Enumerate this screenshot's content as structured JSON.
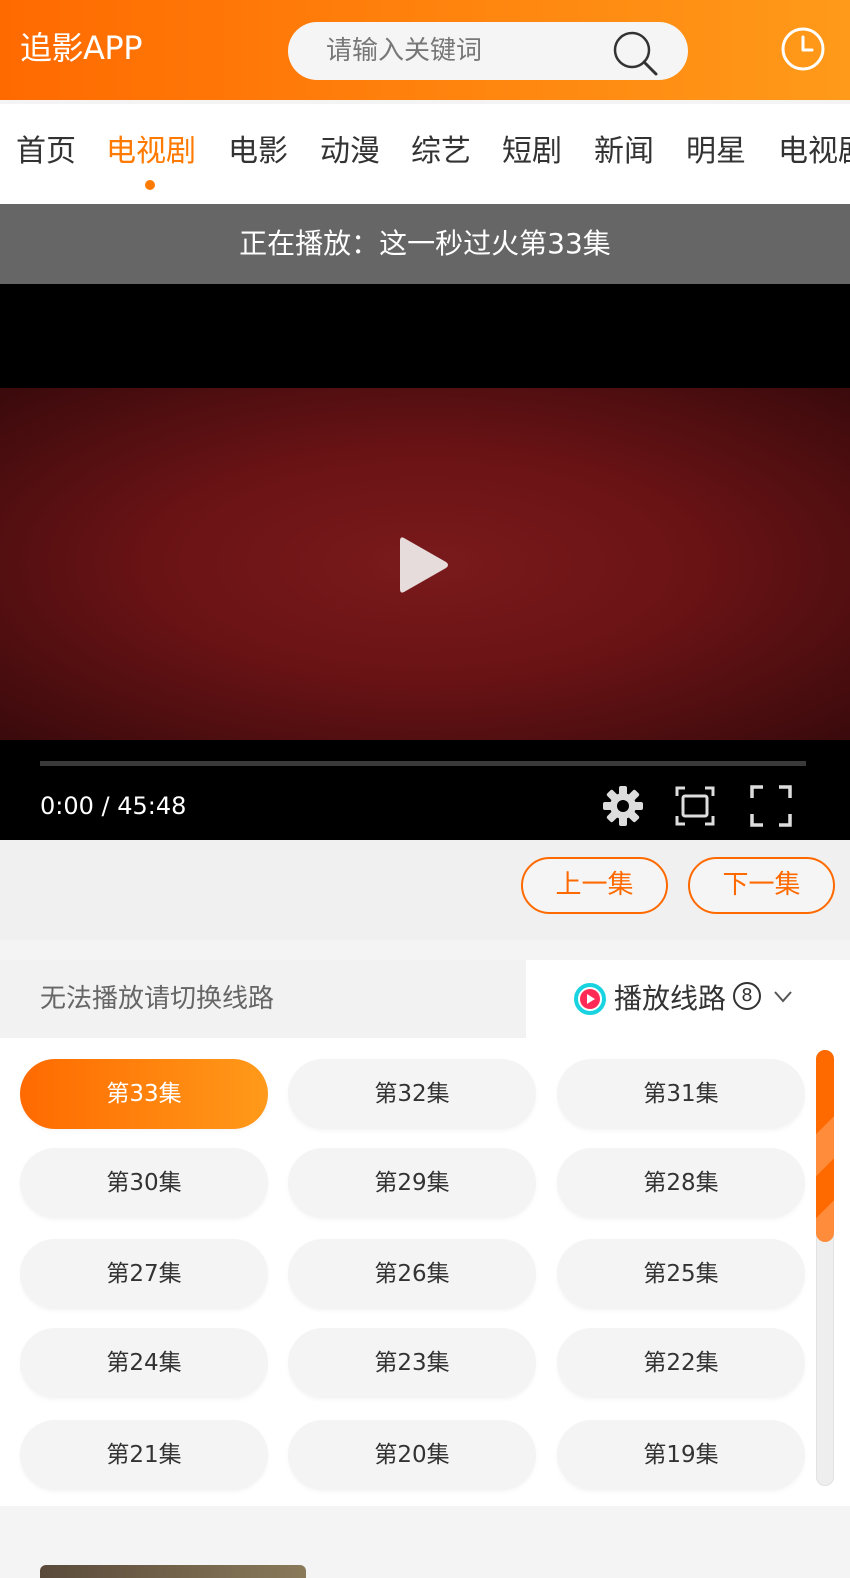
{
  "header": {
    "logo": "追影APP",
    "search_placeholder": "请输入关键词"
  },
  "nav": {
    "items": [
      "首页",
      "电视剧",
      "电影",
      "动漫",
      "综艺",
      "短剧",
      "新闻",
      "明星",
      "电视剧"
    ],
    "active_index": 1
  },
  "now_playing": "正在播放：这一秒过火第33集",
  "player": {
    "time": "0:00 / 45:48",
    "progress": 0
  },
  "episode_nav": {
    "prev": "上一集",
    "next": "下一集"
  },
  "route": {
    "tip": "无法播放请切换线路",
    "label": "播放线路",
    "number": "8"
  },
  "episodes": [
    "第33集",
    "第32集",
    "第31集",
    "第30集",
    "第29集",
    "第28集",
    "第27集",
    "第26集",
    "第25集",
    "第24集",
    "第23集",
    "第22集",
    "第21集",
    "第20集",
    "第19集"
  ],
  "active_episode": "第33集",
  "colors": {
    "accent": "#ff7a00",
    "accent_gradient_start": "#ff6a00",
    "accent_gradient_end": "#ff9a1a"
  },
  "icons": {
    "search": "search-icon",
    "history": "clock-icon",
    "play": "play-icon",
    "settings": "gear-icon",
    "theater": "theater-mode-icon",
    "fullscreen": "fullscreen-icon",
    "route": "route-play-icon",
    "chevron": "chevron-down-icon"
  }
}
